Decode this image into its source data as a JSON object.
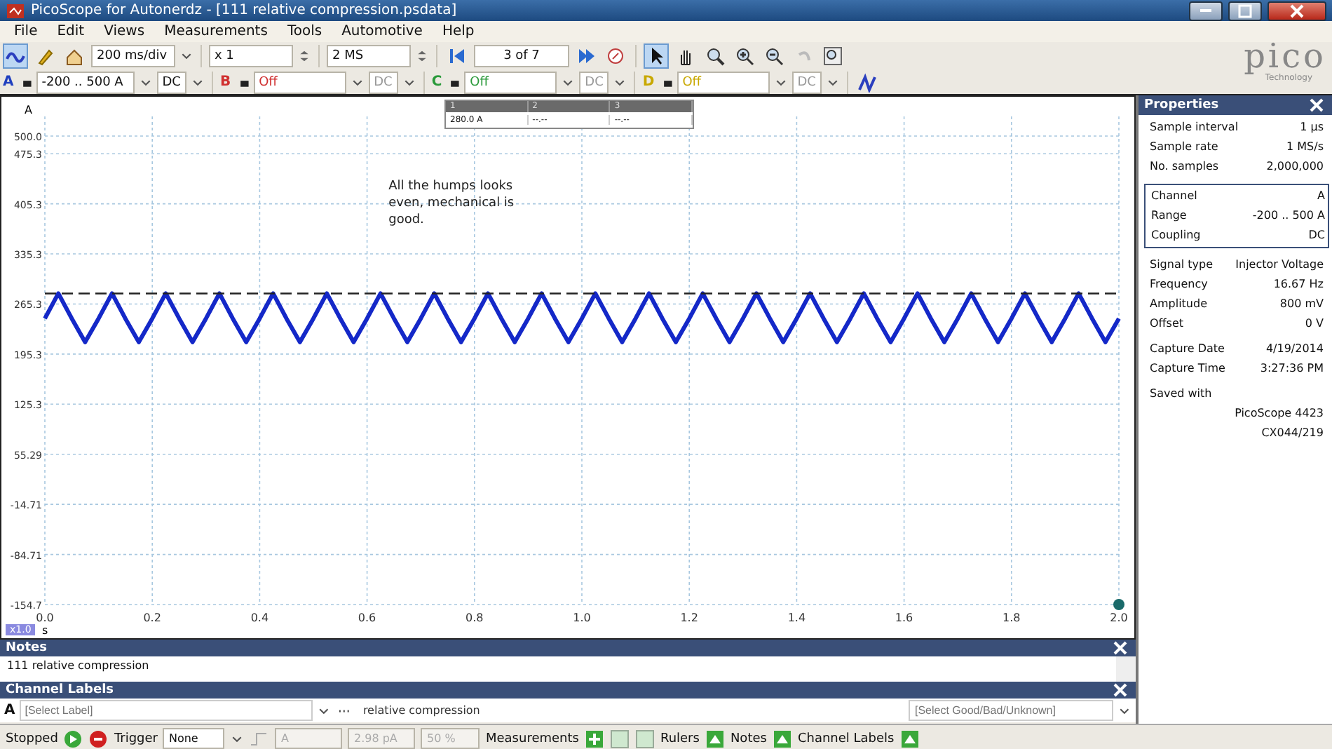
{
  "window": {
    "title": "PicoScope for Autonerdz - [111 relative compression.psdata]"
  },
  "menu": [
    {
      "label": "File"
    },
    {
      "label": "Edit"
    },
    {
      "label": "Views"
    },
    {
      "label": "Measurements"
    },
    {
      "label": "Tools"
    },
    {
      "label": "Automotive"
    },
    {
      "label": "Help"
    }
  ],
  "toolbar": {
    "timebase": "200 ms/div",
    "zoom": "x 1",
    "samples": "2 MS",
    "buffer": "3 of 7",
    "tools": [
      {
        "kind": "pointer",
        "selected": true
      },
      {
        "kind": "hand",
        "selected": false
      },
      {
        "kind": "zoom",
        "selected": false
      },
      {
        "kind": "zoom-in",
        "selected": false
      },
      {
        "kind": "zoom-out",
        "selected": false
      },
      {
        "kind": "undo",
        "selected": false
      },
      {
        "kind": "zoom-fit",
        "selected": false
      }
    ]
  },
  "logo": {
    "name": "pico",
    "tagline": "Technology"
  },
  "channels": [
    {
      "letter": "A",
      "range": "-200 .. 500 A",
      "coupling": "DC",
      "color": "#1f3fbf",
      "enabled": true
    },
    {
      "letter": "B",
      "range": "Off",
      "coupling": "DC",
      "color": "#d03030",
      "enabled": false
    },
    {
      "letter": "C",
      "range": "Off",
      "coupling": "DC",
      "color": "#2a9a3a",
      "enabled": false
    },
    {
      "letter": "D",
      "range": "Off",
      "coupling": "DC",
      "color": "#c8a800",
      "enabled": false
    }
  ],
  "measurement_table": {
    "columns": [
      "1",
      "2",
      "3"
    ],
    "row": [
      "280.0 A",
      "--.--",
      "--.--"
    ]
  },
  "chart": {
    "zoom_badge": "x1.0",
    "chart_data": {
      "type": "line",
      "xlabel": "s",
      "ylabel": "A",
      "xlim": [
        0,
        2
      ],
      "ylim": [
        -154.71,
        500
      ],
      "xticks": [
        {
          "value": 0,
          "label": "0.0"
        },
        {
          "value": 0.2,
          "label": "0.2"
        },
        {
          "value": 0.4,
          "label": "0.4"
        },
        {
          "value": 0.6,
          "label": "0.6"
        },
        {
          "value": 0.8,
          "label": "0.8"
        },
        {
          "value": 1.0,
          "label": "1.0"
        },
        {
          "value": 1.2,
          "label": "1.2"
        },
        {
          "value": 1.4,
          "label": "1.4"
        },
        {
          "value": 1.6,
          "label": "1.6"
        },
        {
          "value": 1.8,
          "label": "1.8"
        },
        {
          "value": 2.0,
          "label": "2.0"
        }
      ],
      "yticks": [
        {
          "value": 500,
          "label": "500.0"
        },
        {
          "value": 475.3,
          "label": "475.3"
        },
        {
          "value": 405.3,
          "label": "405.3"
        },
        {
          "value": 335.3,
          "label": "335.3"
        },
        {
          "value": 265.3,
          "label": "265.3"
        },
        {
          "value": 195.3,
          "label": "195.3"
        },
        {
          "value": 125.3,
          "label": "125.3"
        },
        {
          "value": 55.29,
          "label": "55.29"
        },
        {
          "value": -14.71,
          "label": "-14.71"
        },
        {
          "value": -84.71,
          "label": "-84.71"
        },
        {
          "value": -154.71,
          "label": "-154.7"
        }
      ],
      "x": [
        0,
        0.025,
        0.05,
        0.075,
        0.1,
        0.125,
        0.15,
        0.175,
        0.2,
        0.225,
        0.25,
        0.275,
        0.3,
        0.325,
        0.35,
        0.375,
        0.4,
        0.425,
        0.45,
        0.475,
        0.5,
        0.525,
        0.55,
        0.575,
        0.6,
        0.625,
        0.65,
        0.675,
        0.7,
        0.725,
        0.75,
        0.775,
        0.8,
        0.825,
        0.85,
        0.875,
        0.9,
        0.925,
        0.95,
        0.975,
        1.0,
        1.025,
        1.05,
        1.075,
        1.1,
        1.125,
        1.15,
        1.175,
        1.2,
        1.225,
        1.25,
        1.275,
        1.3,
        1.325,
        1.35,
        1.375,
        1.4,
        1.425,
        1.45,
        1.475,
        1.5,
        1.525,
        1.55,
        1.575,
        1.6,
        1.625,
        1.65,
        1.675,
        1.7,
        1.725,
        1.75,
        1.775,
        1.8,
        1.825,
        1.85,
        1.875,
        1.9,
        1.925,
        1.95,
        1.975,
        2.0
      ],
      "series": [
        {
          "color": "#1428c8",
          "values": [
            245,
            280,
            245,
            212,
            245,
            280,
            245,
            212,
            245,
            280,
            245,
            212,
            245,
            280,
            245,
            212,
            245,
            280,
            245,
            212,
            245,
            280,
            245,
            212,
            245,
            280,
            245,
            212,
            245,
            280,
            245,
            212,
            245,
            280,
            245,
            212,
            245,
            280,
            245,
            212,
            245,
            280,
            245,
            212,
            245,
            280,
            245,
            212,
            245,
            280,
            245,
            212,
            245,
            280,
            245,
            212,
            245,
            280,
            245,
            212,
            245,
            280,
            245,
            212,
            245,
            280,
            245,
            212,
            245,
            280,
            245,
            212,
            245,
            280,
            245,
            212,
            245,
            280,
            245,
            212,
            245
          ]
        }
      ],
      "grid": true,
      "ref_lines": [
        {
          "axis": "y",
          "value": 280
        }
      ],
      "annotations": [
        "All the humps looks even, mechanical is good."
      ]
    }
  },
  "properties": {
    "title": "Properties",
    "groups": [
      {
        "boxed": false,
        "rows": [
          {
            "label": "Sample interval",
            "value": "1 µs"
          },
          {
            "label": "Sample rate",
            "value": "1 MS/s"
          },
          {
            "label": "No. samples",
            "value": "2,000,000"
          }
        ]
      },
      {
        "boxed": true,
        "rows": [
          {
            "label": "Channel",
            "value": "A"
          },
          {
            "label": "Range",
            "value": "-200 .. 500 A"
          },
          {
            "label": "Coupling",
            "value": "DC"
          }
        ]
      },
      {
        "boxed": false,
        "rows": [
          {
            "label": "Signal type",
            "value": "Injector Voltage"
          },
          {
            "label": "Frequency",
            "value": "16.67 Hz"
          },
          {
            "label": "Amplitude",
            "value": "800 mV"
          },
          {
            "label": "Offset",
            "value": "0 V"
          }
        ]
      },
      {
        "boxed": false,
        "rows": [
          {
            "label": "Capture Date",
            "value": "4/19/2014"
          },
          {
            "label": "Capture Time",
            "value": "3:27:36 PM"
          }
        ]
      },
      {
        "boxed": false,
        "rows": [
          {
            "label": "Saved with"
          },
          {
            "value": "PicoScope 4423"
          },
          {
            "value": "CX044/219"
          }
        ]
      }
    ]
  },
  "notes": {
    "title": "Notes",
    "text": "111 relative compression"
  },
  "channel_labels": {
    "title": "Channel Labels",
    "channel": "A",
    "label_placeholder": "[Select Label]",
    "description": "relative compression",
    "verdict_placeholder": "[Select Good/Bad/Unknown]"
  },
  "status_bar": {
    "state": "Stopped",
    "trigger_label": "Trigger",
    "trigger_mode": "None",
    "trigger_source": "A",
    "trigger_level": "2.98 pA",
    "pretrigger": "50 %",
    "toggles": [
      {
        "label": "Measurements"
      },
      {
        "label": "Rulers"
      },
      {
        "label": "Notes"
      },
      {
        "label": "Channel Labels"
      }
    ]
  }
}
